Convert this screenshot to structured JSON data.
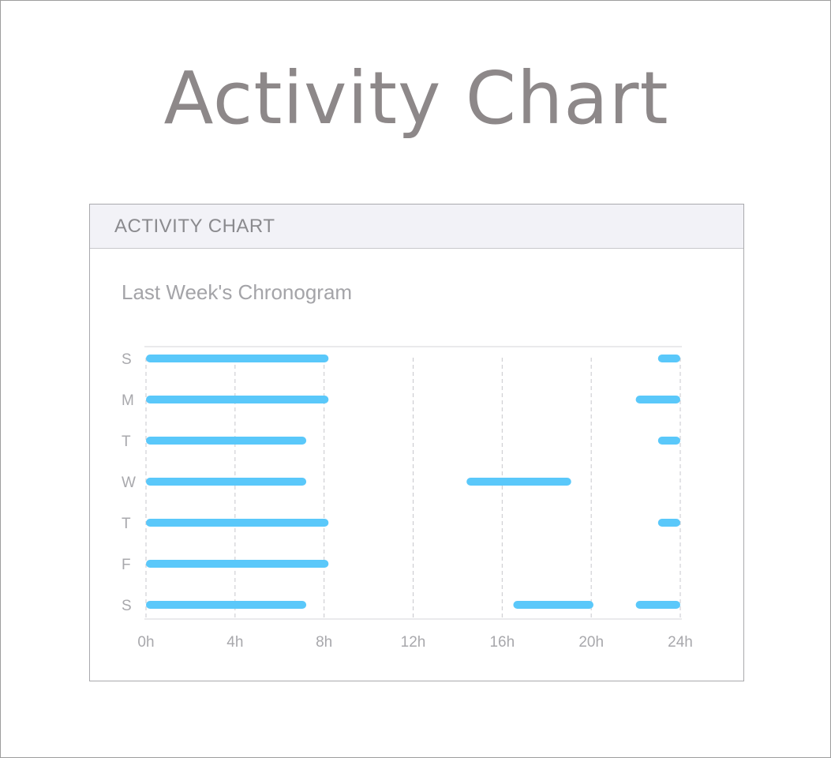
{
  "page": {
    "title": "Activity Chart"
  },
  "card": {
    "header": "ACTIVITY CHART",
    "subtitle": "Last Week's Chronogram"
  },
  "colors": {
    "bar": "#5ac8fa",
    "grid": "#c7c7cc",
    "axis": "#d4d4d8",
    "label": "#a8a8ac"
  },
  "chart_data": {
    "type": "timeline",
    "title": "Last Week's Chronogram",
    "xlim": [
      0,
      24
    ],
    "x_ticks": [
      0,
      4,
      8,
      12,
      16,
      20,
      24
    ],
    "x_tick_labels": [
      "0h",
      "4h",
      "8h",
      "12h",
      "16h",
      "20h",
      "24h"
    ],
    "grid": "vertical-dashed",
    "days": [
      {
        "label": "S",
        "intervals": [
          [
            0,
            8.2
          ],
          [
            23,
            24
          ]
        ]
      },
      {
        "label": "M",
        "intervals": [
          [
            0,
            8.2
          ],
          [
            22,
            24
          ]
        ]
      },
      {
        "label": "T",
        "intervals": [
          [
            0,
            7.2
          ],
          [
            23,
            24
          ]
        ]
      },
      {
        "label": "W",
        "intervals": [
          [
            0,
            7.2
          ],
          [
            14.4,
            19.1
          ]
        ]
      },
      {
        "label": "T",
        "intervals": [
          [
            0,
            8.2
          ],
          [
            23,
            24
          ]
        ]
      },
      {
        "label": "F",
        "intervals": [
          [
            0,
            8.2
          ]
        ]
      },
      {
        "label": "S",
        "intervals": [
          [
            0,
            7.2
          ],
          [
            16.5,
            20.1
          ],
          [
            22,
            24
          ]
        ]
      }
    ]
  }
}
